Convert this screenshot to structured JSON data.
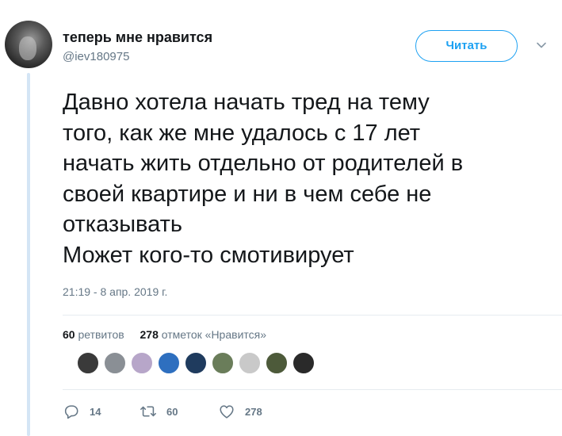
{
  "user": {
    "display_name": "теперь мне нравится",
    "handle": "@iev180975"
  },
  "follow_button": {
    "label": "Читать"
  },
  "tweet": {
    "lines": [
      "Давно хотела начать тред на тему",
      "того, как же мне удалось с 17 лет",
      "начать жить отдельно от родителей в",
      "своей квартире и ни в чем себе не",
      "отказывать",
      "Может кого-то смотивирует"
    ],
    "timestamp": "21:19 - 8 апр. 2019 г."
  },
  "stats": {
    "retweets_count": "60",
    "retweets_label": "ретвитов",
    "likes_count": "278",
    "likes_label": "отметок «Нравится»"
  },
  "likers": [
    {
      "color": "#3a3a3a"
    },
    {
      "color": "#8a8f95"
    },
    {
      "color": "#b7a6c9"
    },
    {
      "color": "#2e6fbf"
    },
    {
      "color": "#1f3b5e"
    },
    {
      "color": "#6a7d5a"
    },
    {
      "color": "#c9c9c9"
    },
    {
      "color": "#4d5a3a"
    },
    {
      "color": "#2a2a2a"
    }
  ],
  "actions": {
    "replies": "14",
    "retweets": "60",
    "likes": "278"
  },
  "icons": {
    "reply": "reply-icon",
    "retweet": "retweet-icon",
    "like": "heart-icon",
    "more": "chevron-down-icon"
  },
  "colors": {
    "accent": "#1da1f2",
    "muted": "#657786",
    "thread_line": "#d4e5f5"
  }
}
